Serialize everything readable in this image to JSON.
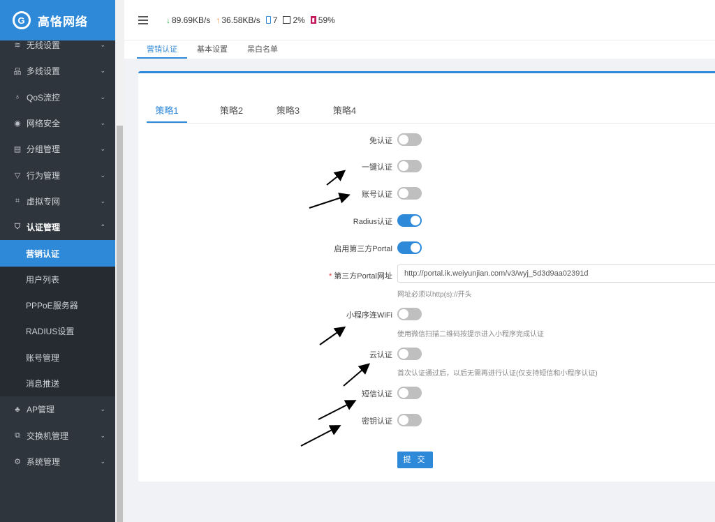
{
  "brand": {
    "name": "高恪网络"
  },
  "sidebar": {
    "items": [
      {
        "label": "无线设置",
        "icon": "wifi-icon"
      },
      {
        "label": "多线设置",
        "icon": "multiline-icon"
      },
      {
        "label": "QoS流控",
        "icon": "bulb-icon"
      },
      {
        "label": "网络安全",
        "icon": "shield-icon"
      },
      {
        "label": "分组管理",
        "icon": "group-icon"
      },
      {
        "label": "行为管理",
        "icon": "filter-icon"
      },
      {
        "label": "虚拟专网",
        "icon": "vpn-icon"
      },
      {
        "label": "认证管理",
        "icon": "check-shield-icon"
      }
    ],
    "auth_sub": [
      {
        "label": "营销认证",
        "active": true
      },
      {
        "label": "用户列表"
      },
      {
        "label": "PPPoE服务器"
      },
      {
        "label": "RADIUS设置"
      },
      {
        "label": "账号管理"
      },
      {
        "label": "消息推送"
      }
    ],
    "bottom_items": [
      {
        "label": "AP管理",
        "icon": "ap-icon"
      },
      {
        "label": "交换机管理",
        "icon": "switch-icon"
      },
      {
        "label": "系统管理",
        "icon": "gear-icon"
      }
    ]
  },
  "topbar": {
    "download": "89.69KB/s",
    "upload": "36.58KB/s",
    "devices": "7",
    "cpu": "2%",
    "memory": "59%"
  },
  "top_tabs": [
    "营销认证",
    "基本设置",
    "黑白名单"
  ],
  "strategy_tabs": [
    "策略1",
    "策略2",
    "策略3",
    "策略4"
  ],
  "form": {
    "free_auth": {
      "label": "免认证",
      "on": false
    },
    "onekey_auth": {
      "label": "一键认证",
      "on": false
    },
    "account_auth": {
      "label": "账号认证",
      "on": false
    },
    "radius_auth": {
      "label": "Radius认证",
      "on": true
    },
    "third_portal": {
      "label": "启用第三方Portal",
      "on": true
    },
    "portal_url": {
      "label": "第三方Portal网址",
      "value": "http://portal.ik.weiyunjian.com/v3/wyj_5d3d9aa02391d",
      "help": "网址必须以http(s)://开头"
    },
    "miniapp_wifi": {
      "label": "小程序连WiFi",
      "on": false,
      "help": "使用微信扫描二维码按提示进入小程序完成认证"
    },
    "cloud_auth": {
      "label": "云认证",
      "on": false,
      "help": "首次认证通过后，以后无需再进行认证(仅支持短信和小程序认证)"
    },
    "sms_auth": {
      "label": "短信认证",
      "on": false
    },
    "key_auth": {
      "label": "密钥认证",
      "on": false
    },
    "submit_label": "提 交"
  },
  "colors": {
    "accent": "#2f89d9",
    "sidebar_bg": "#2f353d",
    "toggle_off": "#bfbfbf"
  }
}
